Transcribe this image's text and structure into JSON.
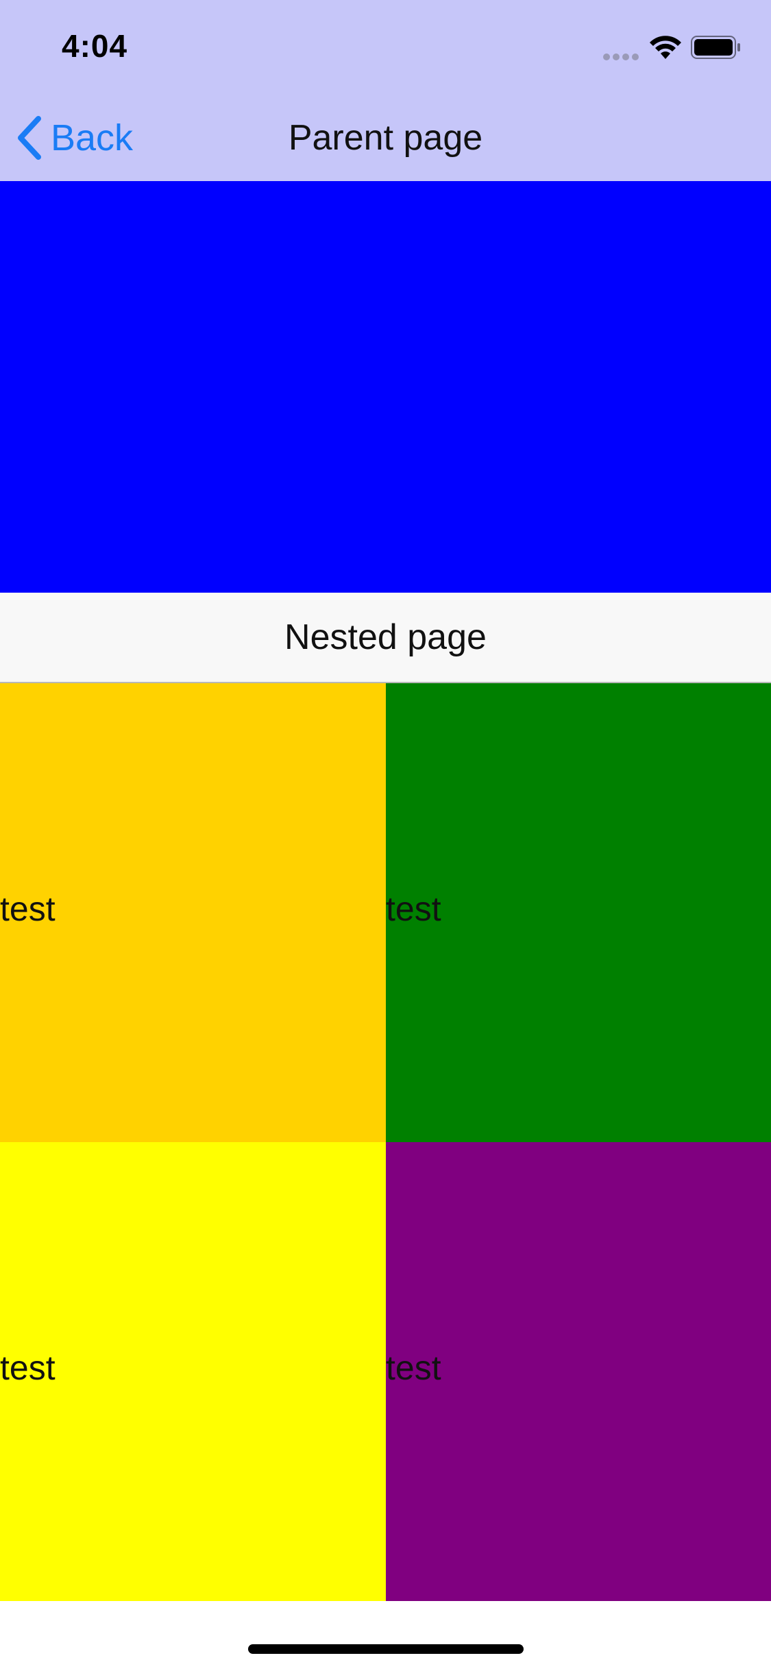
{
  "status_bar": {
    "time": "4:04",
    "icons": [
      "signal-dots-icon",
      "wifi-icon",
      "battery-icon"
    ]
  },
  "nav_bar": {
    "back_label": "Back",
    "title": "Parent page",
    "background": "#c6c6f9",
    "accent": "#1a7cf5"
  },
  "header_panel": {
    "color": "#0000ff"
  },
  "nested_page": {
    "title": "Nested page"
  },
  "grid": {
    "cells": [
      {
        "label": "test",
        "color": "#ffd200"
      },
      {
        "label": "test",
        "color": "#008000"
      },
      {
        "label": "test",
        "color": "#ffff00"
      },
      {
        "label": "test",
        "color": "#800080"
      }
    ]
  }
}
